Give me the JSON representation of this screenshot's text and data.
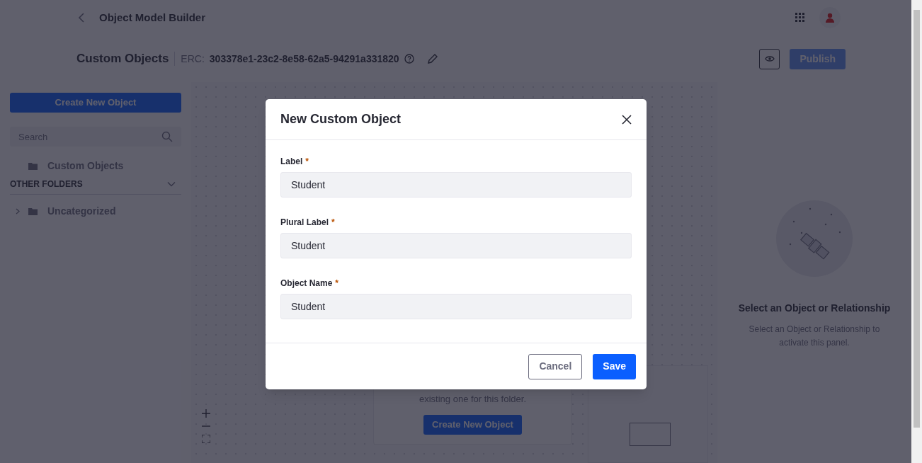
{
  "header": {
    "back_title": "Object Model Builder"
  },
  "toolbar": {
    "title": "Custom Objects",
    "erc_label": "ERC:",
    "erc_value": "303378e1-23c2-8e58-62a5-94291a331820",
    "publish": "Publish"
  },
  "sidebar": {
    "create_button": "Create New Object",
    "search": {
      "placeholder": "Search"
    },
    "folders": [
      {
        "label": "Custom Objects",
        "expandable": false
      }
    ],
    "section": {
      "title": "OTHER FOLDERS",
      "expanded": true
    },
    "other_folders": [
      {
        "label": "Uncategorized",
        "expandable": true
      }
    ]
  },
  "canvas": {
    "empty_text": "existing one for this folder.",
    "create_button": "Create New Object"
  },
  "side_panel": {
    "title": "Select an Object or Relationship",
    "description": "Select an Object or Relationship to activate this panel."
  },
  "modal": {
    "title": "New Custom Object",
    "fields": [
      {
        "label": "Label",
        "required_mark": "*",
        "value": "Student"
      },
      {
        "label": "Plural Label",
        "required_mark": "*",
        "value": "Student"
      },
      {
        "label": "Object Name",
        "required_mark": "*",
        "value": "Student"
      }
    ],
    "buttons": [
      {
        "label": "Cancel",
        "kind": "secondary"
      },
      {
        "label": "Save",
        "kind": "primary"
      }
    ]
  }
}
